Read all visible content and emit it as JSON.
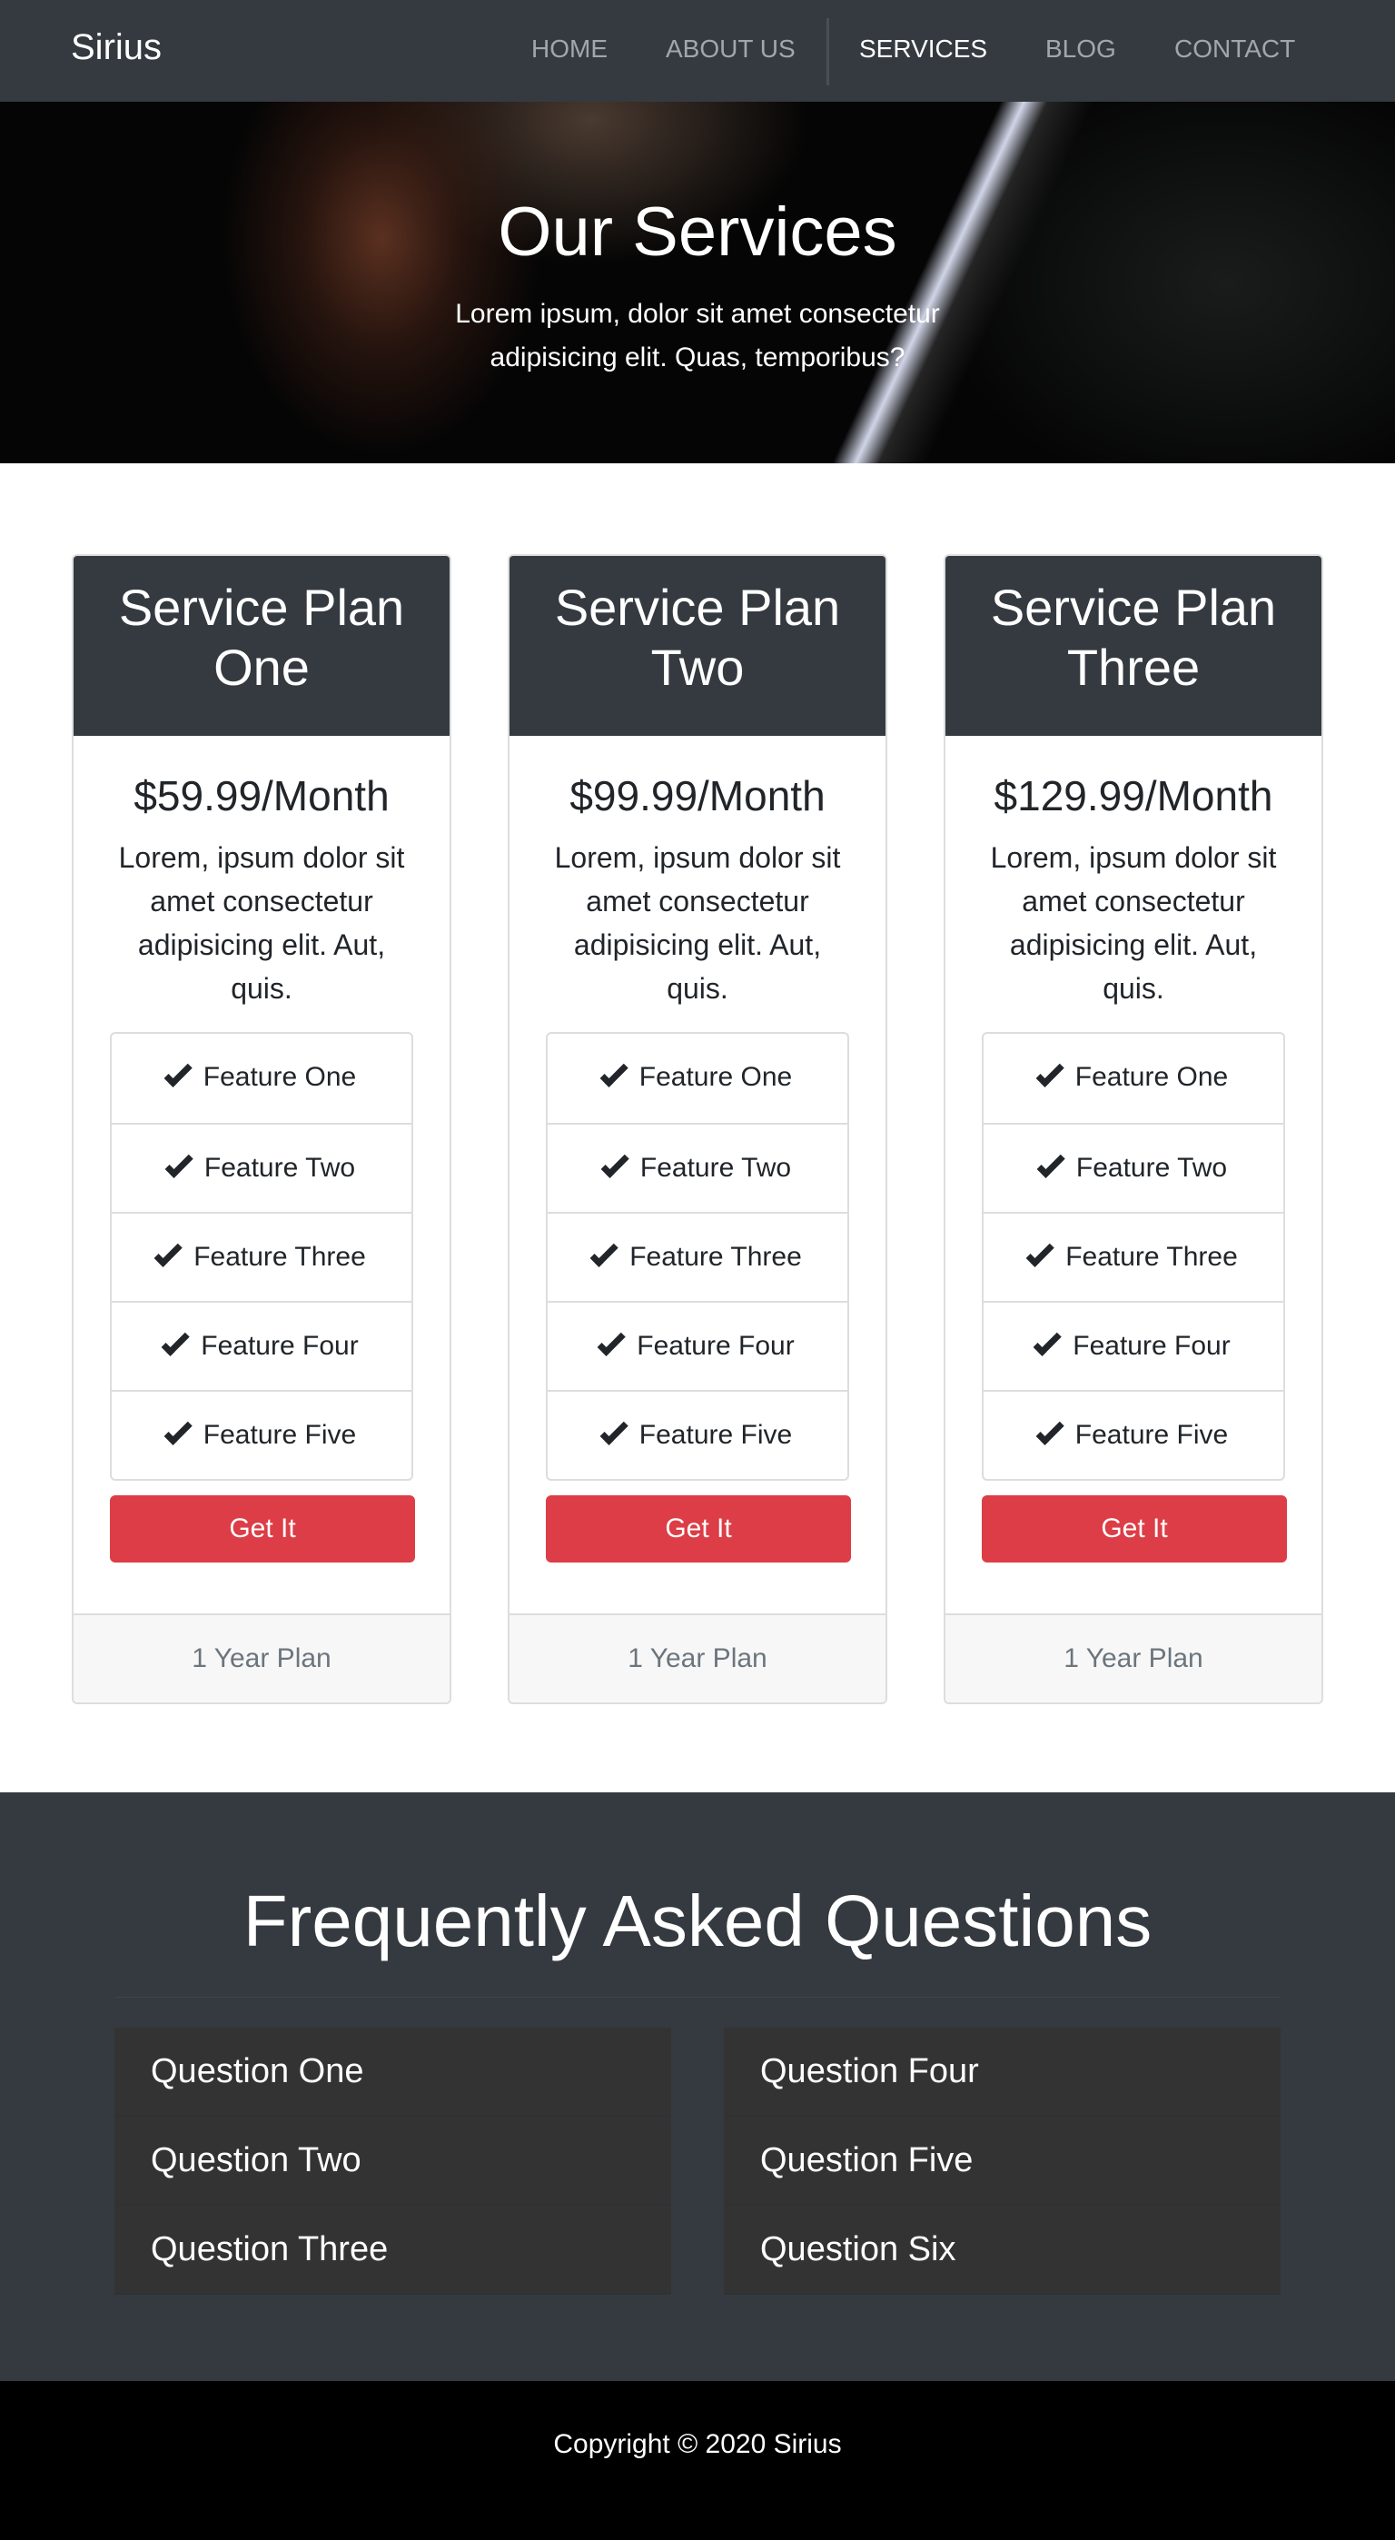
{
  "nav": {
    "brand": "Sirius",
    "links": [
      "HOME",
      "ABOUT US",
      "SERVICES",
      "BLOG",
      "CONTACT"
    ],
    "active": "SERVICES"
  },
  "hero": {
    "title": "Our Services",
    "subtitle": "Lorem ipsum, dolor sit amet consectetur adipisicing elit. Quas, temporibus?"
  },
  "plans": [
    {
      "title": "Service Plan One",
      "price": "$59.99/Month",
      "desc": "Lorem, ipsum dolor sit amet consectetur adipisicing elit. Aut, quis.",
      "features": [
        "Feature One",
        "Feature Two",
        "Feature Three",
        "Feature Four",
        "Feature Five"
      ],
      "button": "Get It",
      "footer": "1 Year Plan"
    },
    {
      "title": "Service Plan Two",
      "price": "$99.99/Month",
      "desc": "Lorem, ipsum dolor sit amet consectetur adipisicing elit. Aut, quis.",
      "features": [
        "Feature One",
        "Feature Two",
        "Feature Three",
        "Feature Four",
        "Feature Five"
      ],
      "button": "Get It",
      "footer": "1 Year Plan"
    },
    {
      "title": "Service Plan Three",
      "price": "$129.99/Month",
      "desc": "Lorem, ipsum dolor sit amet consectetur adipisicing elit. Aut, quis.",
      "features": [
        "Feature One",
        "Feature Two",
        "Feature Three",
        "Feature Four",
        "Feature Five"
      ],
      "button": "Get It",
      "footer": "1 Year Plan"
    }
  ],
  "faq": {
    "title": "Frequently Asked Questions",
    "questions": [
      "Question One",
      "Question Two",
      "Question Three",
      "Question Four",
      "Question Five",
      "Question Six"
    ]
  },
  "footer": {
    "copyright": "Copyright © 2020 Sirius"
  },
  "colors": {
    "dark": "#343a40",
    "accent": "#dc3d46"
  }
}
